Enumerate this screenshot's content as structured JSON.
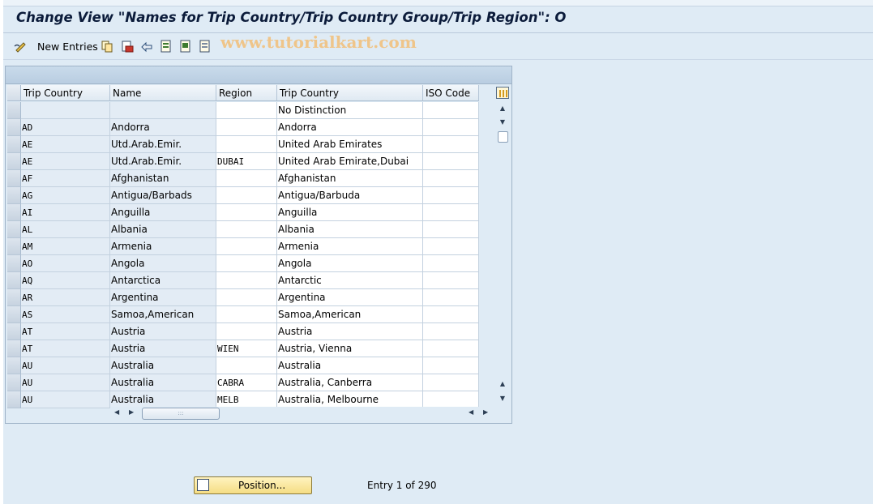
{
  "title": "Change View \"Names for Trip Country/Trip Country Group/Trip Region\": O",
  "toolbar": {
    "new_entries_label": "New Entries",
    "watermark": "www.tutorialkart.com",
    "icons": [
      "pencil-glasses-icon",
      "copy-icon",
      "delete-icon",
      "undo-icon",
      "select-all-icon",
      "select-block-icon",
      "deselect-all-icon"
    ]
  },
  "table": {
    "columns": [
      "Trip Country",
      "Name",
      "Region",
      "Trip Country",
      "ISO Code"
    ],
    "rows": [
      {
        "code": "",
        "name": "",
        "region": "",
        "trip_country": "No Distinction",
        "iso": ""
      },
      {
        "code": "AD",
        "name": "Andorra",
        "region": "",
        "trip_country": "Andorra",
        "iso": ""
      },
      {
        "code": "AE",
        "name": "Utd.Arab.Emir.",
        "region": "",
        "trip_country": "United Arab Emirates",
        "iso": ""
      },
      {
        "code": "AE",
        "name": "Utd.Arab.Emir.",
        "region": "DUBAI",
        "trip_country": "United Arab Emirate,Dubai",
        "iso": ""
      },
      {
        "code": "AF",
        "name": "Afghanistan",
        "region": "",
        "trip_country": "Afghanistan",
        "iso": ""
      },
      {
        "code": "AG",
        "name": "Antigua/Barbads",
        "region": "",
        "trip_country": "Antigua/Barbuda",
        "iso": ""
      },
      {
        "code": "AI",
        "name": "Anguilla",
        "region": "",
        "trip_country": "Anguilla",
        "iso": ""
      },
      {
        "code": "AL",
        "name": "Albania",
        "region": "",
        "trip_country": "Albania",
        "iso": ""
      },
      {
        "code": "AM",
        "name": "Armenia",
        "region": "",
        "trip_country": "Armenia",
        "iso": ""
      },
      {
        "code": "AO",
        "name": "Angola",
        "region": "",
        "trip_country": "Angola",
        "iso": ""
      },
      {
        "code": "AQ",
        "name": "Antarctica",
        "region": "",
        "trip_country": "Antarctic",
        "iso": ""
      },
      {
        "code": "AR",
        "name": "Argentina",
        "region": "",
        "trip_country": "Argentina",
        "iso": ""
      },
      {
        "code": "AS",
        "name": "Samoa,American",
        "region": "",
        "trip_country": "Samoa,American",
        "iso": ""
      },
      {
        "code": "AT",
        "name": "Austria",
        "region": "",
        "trip_country": "Austria",
        "iso": ""
      },
      {
        "code": "AT",
        "name": "Austria",
        "region": "WIEN",
        "trip_country": "Austria, Vienna",
        "iso": ""
      },
      {
        "code": "AU",
        "name": "Australia",
        "region": "",
        "trip_country": "Australia",
        "iso": ""
      },
      {
        "code": "AU",
        "name": "Australia",
        "region": "CABRA",
        "trip_country": "Australia, Canberra",
        "iso": ""
      },
      {
        "code": "AU",
        "name": "Australia",
        "region": "MELB",
        "trip_country": "Australia, Melbourne",
        "iso": ""
      }
    ]
  },
  "footer": {
    "position_button": "Position...",
    "entry_status": "Entry 1 of 290"
  },
  "colors": {
    "background": "#dfebf5",
    "title_text": "#0b1b3a",
    "watermark": "#efc58a",
    "position_button": "#f5dd84"
  }
}
